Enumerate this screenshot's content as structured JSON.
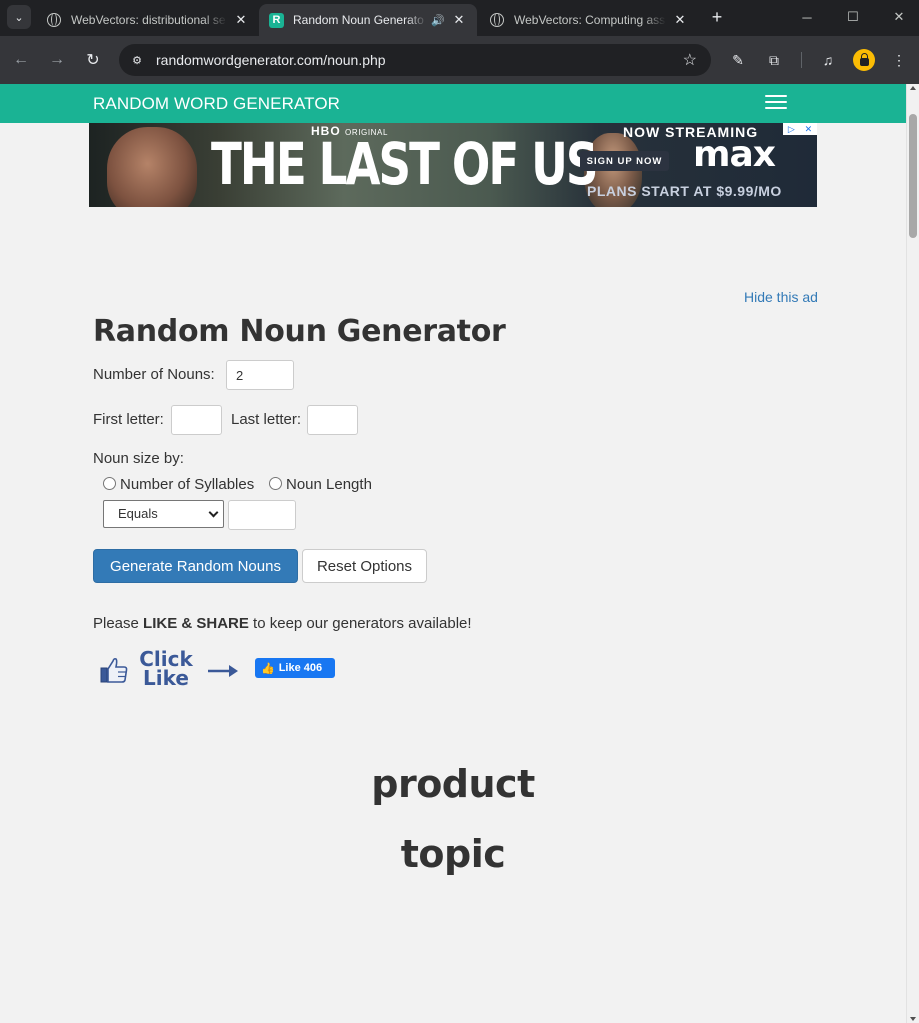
{
  "browser": {
    "tabs": [
      {
        "title": "WebVectors: distributional se",
        "active": false
      },
      {
        "title": "Random Noun Generato",
        "active": true,
        "audio": true
      },
      {
        "title": "WebVectors: Computing ass",
        "active": false
      }
    ],
    "url": "randomwordgenerator.com/noun.php"
  },
  "navbar": {
    "brand": "RANDOM WORD GENERATOR"
  },
  "ad": {
    "network_line": "HBO",
    "network_sub": "ORIGINAL",
    "headline": "THE LAST OF US",
    "streaming": "NOW STREAMING",
    "cta": "SIGN UP NOW",
    "brand": "max",
    "offer": "PLANS START AT $9.99/MO",
    "hide_link": "Hide this ad"
  },
  "form": {
    "title": "Random Noun Generator",
    "num_nouns_label": "Number of Nouns:",
    "num_nouns_value": "2",
    "first_letter_label": "First letter:",
    "first_letter_value": "",
    "last_letter_label": "Last letter:",
    "last_letter_value": "",
    "size_by_label": "Noun size by:",
    "option_syllables": "Number of Syllables",
    "option_length": "Noun Length",
    "compare_select": "Equals",
    "size_value": "",
    "generate_button": "Generate Random Nouns",
    "reset_button": "Reset Options"
  },
  "share": {
    "prefix": "Please ",
    "emphasis": "LIKE & SHARE",
    "suffix": " to keep our generators available!",
    "click_like_1": "Click",
    "click_like_2": "Like",
    "fb_like": "Like 406"
  },
  "results": [
    "product",
    "topic"
  ],
  "colors": {
    "brand_green": "#1ab394",
    "primary_blue": "#337ab7",
    "facebook_blue": "#1877f2"
  }
}
